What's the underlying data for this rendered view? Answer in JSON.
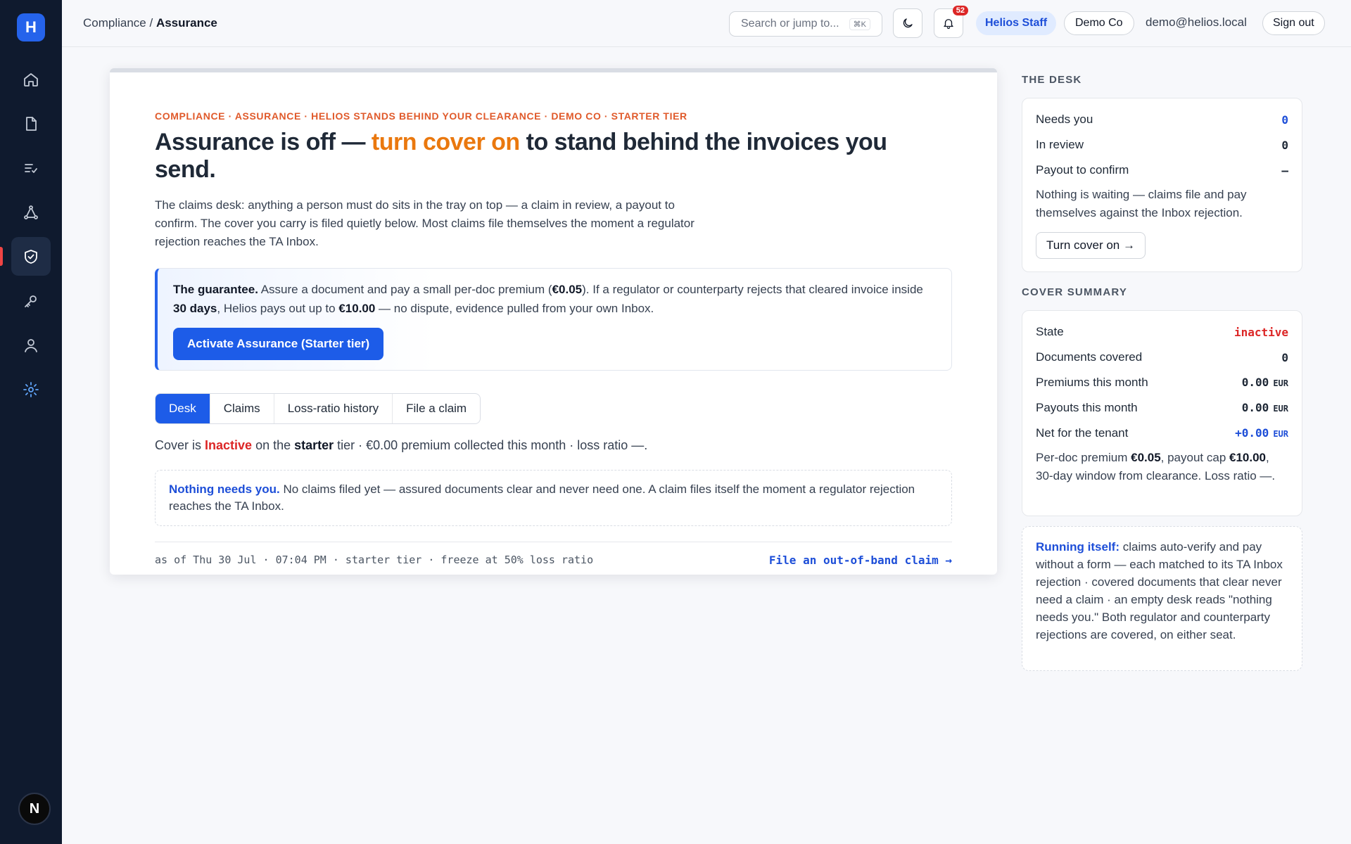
{
  "app": {
    "logo_letter": "H",
    "avatar_letter": "N"
  },
  "sidebar": {
    "items": [
      {
        "name": "home-icon"
      },
      {
        "name": "document-icon"
      },
      {
        "name": "list-check-icon"
      },
      {
        "name": "network-icon"
      },
      {
        "name": "shield-check-icon",
        "active": true
      },
      {
        "name": "key-icon"
      },
      {
        "name": "user-icon"
      },
      {
        "name": "gear-icon"
      }
    ]
  },
  "header": {
    "breadcrumb_parent": "Compliance",
    "breadcrumb_sep": " / ",
    "breadcrumb_current": "Assurance",
    "search_placeholder": "Search or jump to...",
    "search_shortcut": "⌘K",
    "notifications_count": "52",
    "staff_label": "Helios Staff",
    "org_label": "Demo Co",
    "email": "demo@helios.local",
    "signout_label": "Sign out"
  },
  "main": {
    "eyebrow": "COMPLIANCE · ASSURANCE · HELIOS STANDS BEHIND YOUR CLEARANCE · DEMO CO · STARTER TIER",
    "headline_start": "Assurance is off — ",
    "headline_accent": "turn cover on",
    "headline_end": " to stand behind the invoices you send.",
    "lede": "The claims desk: anything a person must do sits in the tray on top — a claim in review, a payout to confirm. The cover you carry is filed quietly below. Most claims file themselves the moment a regulator rejection reaches the TA Inbox.",
    "guarantee": {
      "lead": "The guarantee.",
      "t1": " Assure a document and pay a small per-doc premium (",
      "premium": "€0.05",
      "t2": "). If a regulator or counterparty rejects that cleared invoice inside ",
      "days": "30 days",
      "t3": ", Helios pays out up to ",
      "cap": "€10.00",
      "t4": " — no dispute, evidence pulled from your own Inbox.",
      "button": "Activate Assurance (Starter tier)"
    },
    "tabs": [
      "Desk",
      "Claims",
      "Loss-ratio history",
      "File a claim"
    ],
    "status": {
      "t1": "Cover is ",
      "state": "Inactive",
      "t2": " on the ",
      "tier": "starter",
      "t3": " tier · €0.00 premium collected this month · loss ratio —."
    },
    "nothing": {
      "lead": "Nothing needs you.",
      "text": " No claims filed yet — assured documents clear and never need one. A claim files itself the moment a regulator rejection reaches the TA Inbox."
    },
    "footer_left": "as of Thu 30 Jul · 07:04 PM · starter tier · freeze at 50% loss ratio",
    "footer_link": "File an out-of-band claim →"
  },
  "desk": {
    "title": "THE DESK",
    "rows": [
      {
        "label": "Needs you",
        "value": "0"
      },
      {
        "label": "In review",
        "value": "0"
      },
      {
        "label": "Payout to confirm",
        "value": "–"
      }
    ],
    "note": "Nothing is waiting — claims file and pay themselves against the Inbox rejection.",
    "button": "Turn cover on →"
  },
  "cover": {
    "title": "COVER SUMMARY",
    "rows": [
      {
        "label": "State",
        "value": "inactive",
        "unit": ""
      },
      {
        "label": "Documents covered",
        "value": "0",
        "unit": ""
      },
      {
        "label": "Premiums this month",
        "value": "0.00",
        "unit": "EUR"
      },
      {
        "label": "Payouts this month",
        "value": "0.00",
        "unit": "EUR"
      },
      {
        "label": "Net for the tenant",
        "value": "+0.00",
        "unit": "EUR"
      }
    ],
    "note_t1": "Per-doc premium ",
    "note_premium": "€0.05",
    "note_t2": ", payout cap ",
    "note_cap": "€10.00",
    "note_t3": ", 30-day window from clearance. Loss ratio —."
  },
  "running": {
    "lead": "Running itself:",
    "text": " claims auto-verify and pay without a form — each matched to its TA Inbox rejection · covered documents that clear never need a claim · an empty desk reads \"nothing needs you.\" Both regulator and counterparty rejections are covered, on either seat."
  },
  "colors": {
    "accent": "#1d5ce8",
    "danger": "#dc2626",
    "warn": "#ea780e",
    "sidebar": "#0f1a2e"
  }
}
